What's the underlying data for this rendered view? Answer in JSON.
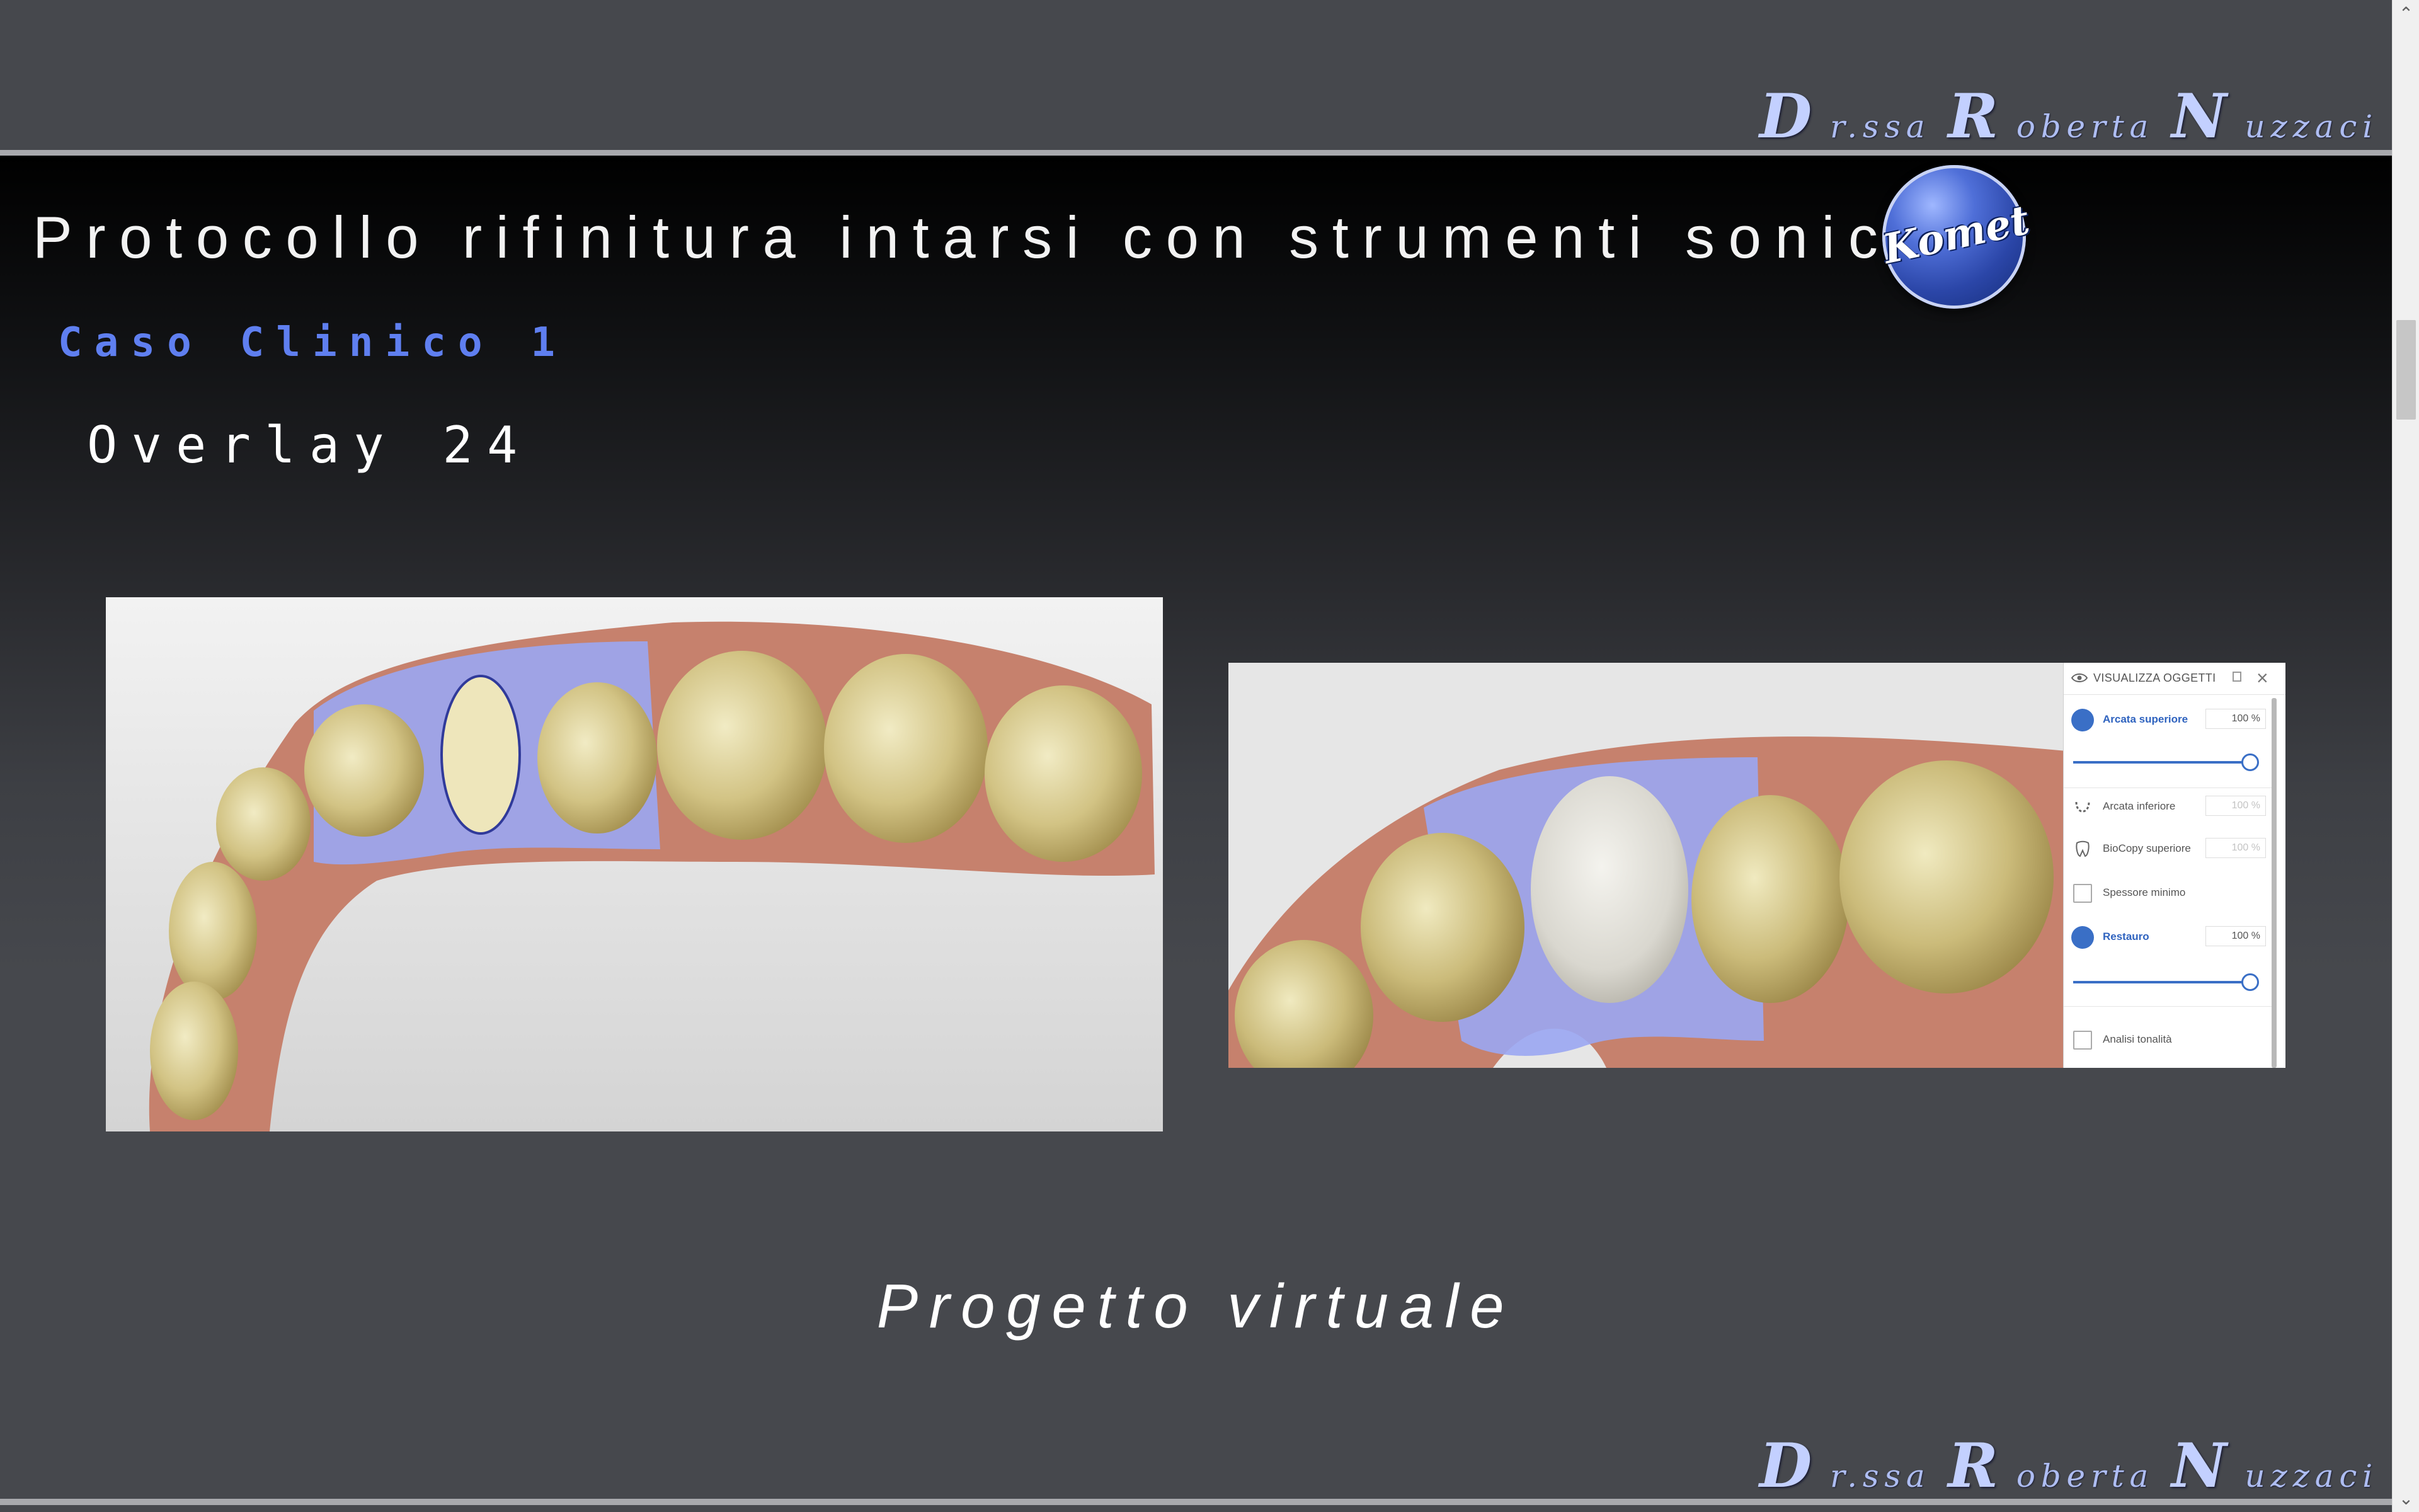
{
  "signature": {
    "first": {
      "initial": "D",
      "rest": "r.ssa"
    },
    "middle": {
      "initial": "R",
      "rest": "oberta"
    },
    "last": {
      "initial": "N",
      "rest": "uzzaci"
    }
  },
  "slide": {
    "title": "Protocollo rifinitura intarsi con strumenti sonici",
    "logo_text": "Komet",
    "subtitle": "Caso Clinico 1",
    "heading": "Overlay 24",
    "caption": "Progetto virtuale"
  },
  "viewer_panel": {
    "title": "VISUALIZZA OGGETTI",
    "rows": [
      {
        "label": "Arcata superiore",
        "value": "100 %",
        "active": true
      },
      {
        "label": "Arcata inferiore",
        "value": "100 %",
        "active": false
      },
      {
        "label": "BioCopy superiore",
        "value": "100 %",
        "active": false
      },
      {
        "label": "Spessore minimo"
      },
      {
        "label": "Restauro",
        "value": "100 %",
        "active": true
      },
      {
        "label": "Analisi tonalità"
      }
    ],
    "sliders": [
      1.0,
      1.0
    ]
  },
  "colors": {
    "accent_blue": "#5f7ff0",
    "signature": "#c3d0ff",
    "panel_blue": "#3a6fc6"
  },
  "icons": [
    "eye-icon",
    "pin-icon",
    "close-icon",
    "arch-icon",
    "checkbox-icon",
    "tooth-icon",
    "scroll-up-icon",
    "scroll-down-icon"
  ]
}
